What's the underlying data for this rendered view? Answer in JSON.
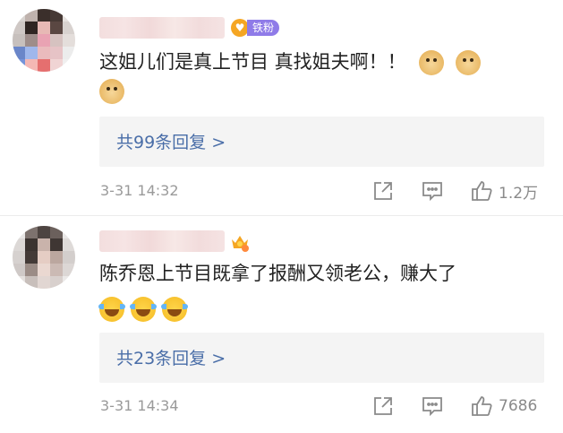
{
  "comments": [
    {
      "fan_badge": "铁粉",
      "text": "这姐儿们是真上节目 真找姐夫啊！！",
      "emoji_icons": [
        "doge-emoji",
        "doge-emoji",
        "doge-emoji"
      ],
      "reply_link": "共99条回复 >",
      "time": "3-31 14:32",
      "likes": "1.2万"
    },
    {
      "text": "陈乔恩上节目既拿了报酬又领老公，赚大了",
      "emoji_icons": [
        "laugh-cry-emoji",
        "laugh-cry-emoji",
        "laugh-cry-emoji"
      ],
      "reply_link": "共23条回复 >",
      "time": "3-31 14:34",
      "likes": "7686"
    }
  ],
  "colors": {
    "link": "#4a6ea8",
    "meta": "#9a9a9a",
    "fan_badge": "#8f7be8",
    "reply_bg": "#f4f4f4"
  }
}
